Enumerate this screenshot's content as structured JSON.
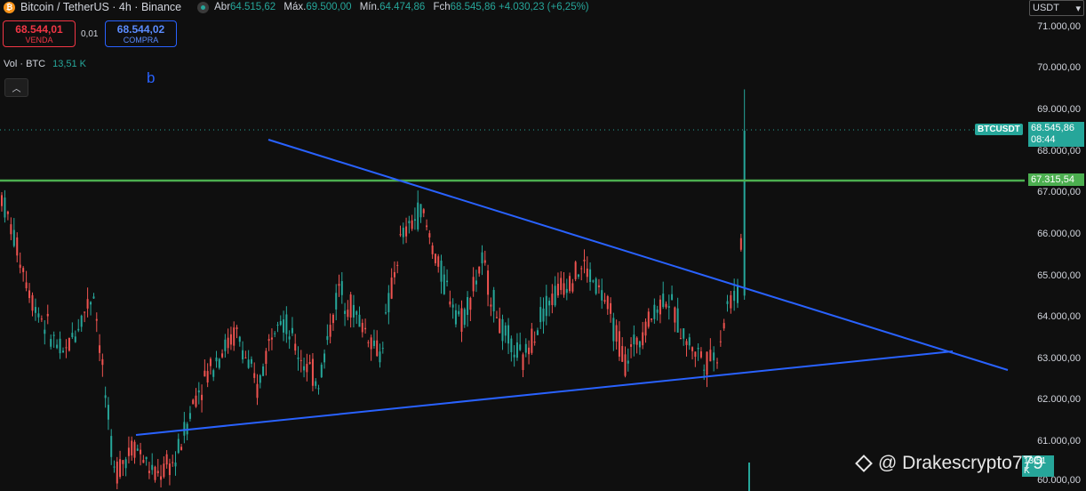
{
  "header": {
    "coin_symbol": "₿",
    "title": "Bitcoin / TetherUS · 4h · Binance",
    "ohlc": [
      {
        "label": "Abr",
        "value": "64.515,62"
      },
      {
        "label": "Máx.",
        "value": "69.500,00"
      },
      {
        "label": "Mín.",
        "value": "64.474,86"
      },
      {
        "label": "Fch",
        "value": "68.545,86 +4.030,23 (+6,25%)"
      }
    ]
  },
  "trade": {
    "sell_price": "68.544,01",
    "sell_label": "VENDA",
    "spread": "0,01",
    "buy_price": "68.544,02",
    "buy_label": "COMPRA"
  },
  "volume": {
    "label": "Vol · BTC",
    "value": "13,51 K"
  },
  "collapse_icon": "chevron-up-icon",
  "marker_label": "b",
  "currency": "USDT",
  "axis": {
    "ticks": [
      "71.000,00",
      "70.000,00",
      "69.000,00",
      "68.000,00",
      "67.000,00",
      "66.000,00",
      "65.000,00",
      "64.000,00",
      "63.000,00",
      "62.000,00",
      "61.000,00",
      "60.000,00"
    ]
  },
  "price_tag": {
    "symbol": "BTCUSDT",
    "price": "68.545,86",
    "countdown": "08:44"
  },
  "level_tag": "67.315,54",
  "volume_tag": "13,51 K",
  "watermark": "@ Drakescrypto779",
  "colors": {
    "up": "#26a69a",
    "down": "#ef5350",
    "trendline": "#2962ff",
    "level": "#4caf50",
    "background": "#0f0f0f"
  },
  "chart_data": {
    "type": "candlestick",
    "price_range": [
      60000,
      71000
    ],
    "current_price": 68545.86,
    "horizontal_level": 67315.54,
    "trendlines": [
      {
        "from": [
          0.25,
          68300
        ],
        "to": [
          0.93,
          62700
        ]
      },
      {
        "from": [
          0.125,
          61150
        ],
        "to": [
          0.88,
          63150
        ]
      }
    ],
    "candles": [
      [
        0.0,
        66200,
        67400,
        65100,
        66900
      ],
      [
        0.03,
        66900,
        67300,
        64000,
        64400
      ],
      [
        0.06,
        64400,
        65500,
        62400,
        63000
      ],
      [
        0.09,
        63000,
        65100,
        62800,
        64600
      ],
      [
        0.11,
        64600,
        64900,
        59600,
        60200
      ],
      [
        0.13,
        60200,
        61400,
        59700,
        60900
      ],
      [
        0.15,
        60900,
        61200,
        59600,
        60100
      ],
      [
        0.17,
        60100,
        60700,
        59700,
        60500
      ],
      [
        0.19,
        60500,
        62300,
        60400,
        62100
      ],
      [
        0.21,
        62100,
        63400,
        61900,
        63000
      ],
      [
        0.23,
        63000,
        64200,
        62600,
        63600
      ],
      [
        0.25,
        63600,
        63900,
        61800,
        62200
      ],
      [
        0.27,
        62200,
        64300,
        62100,
        64200
      ],
      [
        0.29,
        64200,
        64600,
        62600,
        63100
      ],
      [
        0.31,
        63100,
        63500,
        62000,
        62400
      ],
      [
        0.33,
        62400,
        65100,
        62300,
        64700
      ],
      [
        0.35,
        64700,
        65200,
        63500,
        63900
      ],
      [
        0.37,
        63900,
        64400,
        62800,
        63100
      ],
      [
        0.39,
        63100,
        66100,
        63000,
        65800
      ],
      [
        0.41,
        65800,
        67000,
        65200,
        66600
      ],
      [
        0.43,
        66600,
        66700,
        64700,
        65000
      ],
      [
        0.45,
        65000,
        65500,
        63500,
        63900
      ],
      [
        0.47,
        63900,
        65700,
        63700,
        65300
      ],
      [
        0.49,
        65300,
        65800,
        63200,
        63600
      ],
      [
        0.51,
        63600,
        63800,
        62500,
        62900
      ],
      [
        0.53,
        62900,
        64600,
        62700,
        64200
      ],
      [
        0.55,
        64200,
        65400,
        63800,
        64800
      ],
      [
        0.57,
        64800,
        65600,
        64200,
        65200
      ],
      [
        0.59,
        65200,
        65500,
        64100,
        64400
      ],
      [
        0.61,
        64400,
        64900,
        62600,
        62900
      ],
      [
        0.63,
        62900,
        64200,
        62700,
        63800
      ],
      [
        0.65,
        63800,
        64900,
        63500,
        64500
      ],
      [
        0.67,
        64500,
        64800,
        63100,
        63400
      ],
      [
        0.69,
        63400,
        63700,
        62600,
        62900
      ],
      [
        0.7,
        62900,
        63400,
        62700,
        63100
      ],
      [
        0.71,
        63100,
        64500,
        63000,
        64300
      ],
      [
        0.72,
        64300,
        64900,
        64200,
        64500
      ],
      [
        0.73,
        64500,
        69500,
        64400,
        68500
      ]
    ]
  }
}
